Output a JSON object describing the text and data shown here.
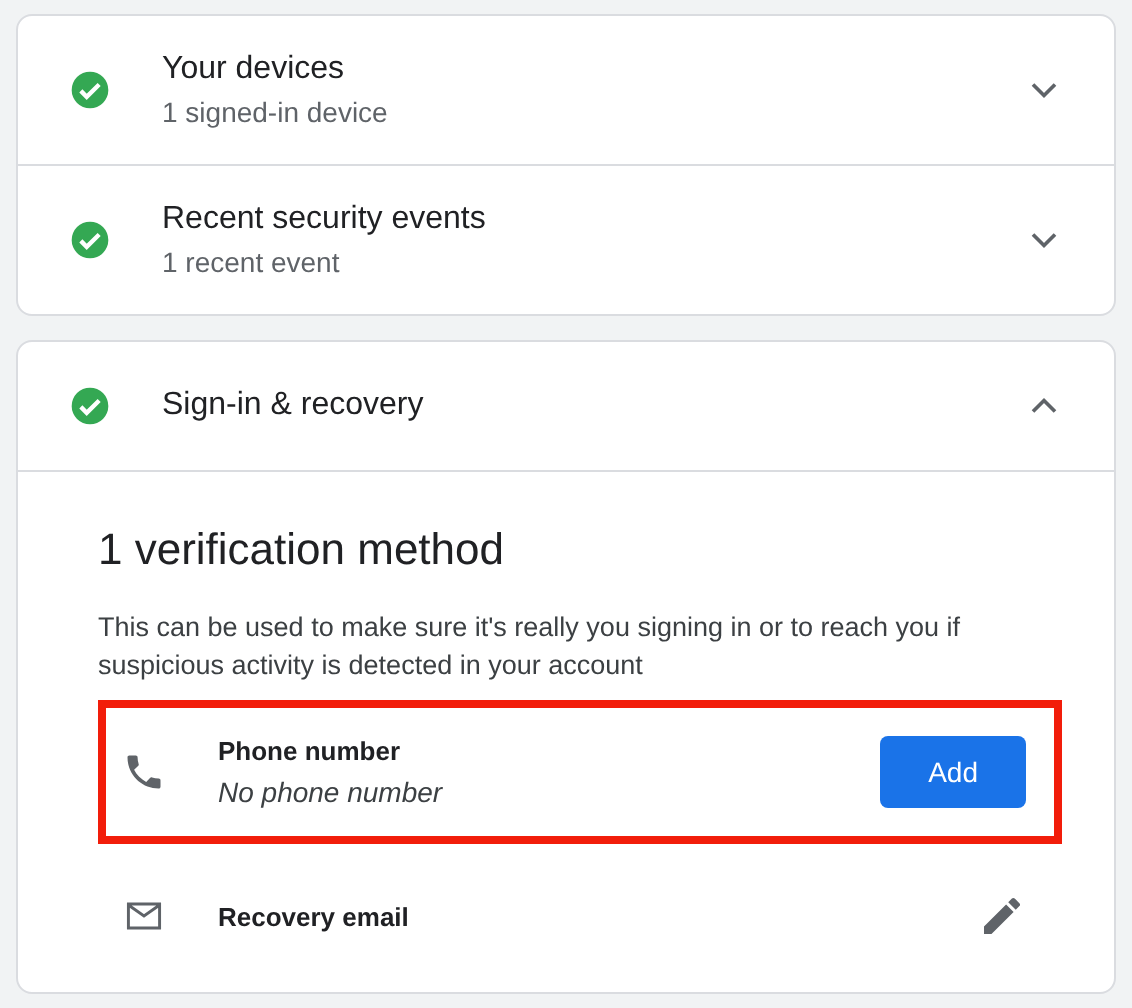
{
  "cards": [
    {
      "sections": [
        {
          "title": "Your devices",
          "subtitle": "1 signed-in device",
          "ok": true,
          "expanded": false
        },
        {
          "title": "Recent security events",
          "subtitle": "1 recent event",
          "ok": true,
          "expanded": false
        }
      ]
    },
    {
      "sections": [
        {
          "title": "Sign-in & recovery",
          "ok": true,
          "expanded": true,
          "content": {
            "heading": "1 verification method",
            "description": "This can be used to make sure it's really you signing in or to reach you if suspicious activity is detected in your account",
            "methods": [
              {
                "kind": "phone",
                "label": "Phone number",
                "value": "No phone number",
                "button": "Add",
                "highlighted": true
              },
              {
                "kind": "email",
                "label": "Recovery email",
                "highlighted": false
              }
            ]
          }
        }
      ]
    }
  ]
}
